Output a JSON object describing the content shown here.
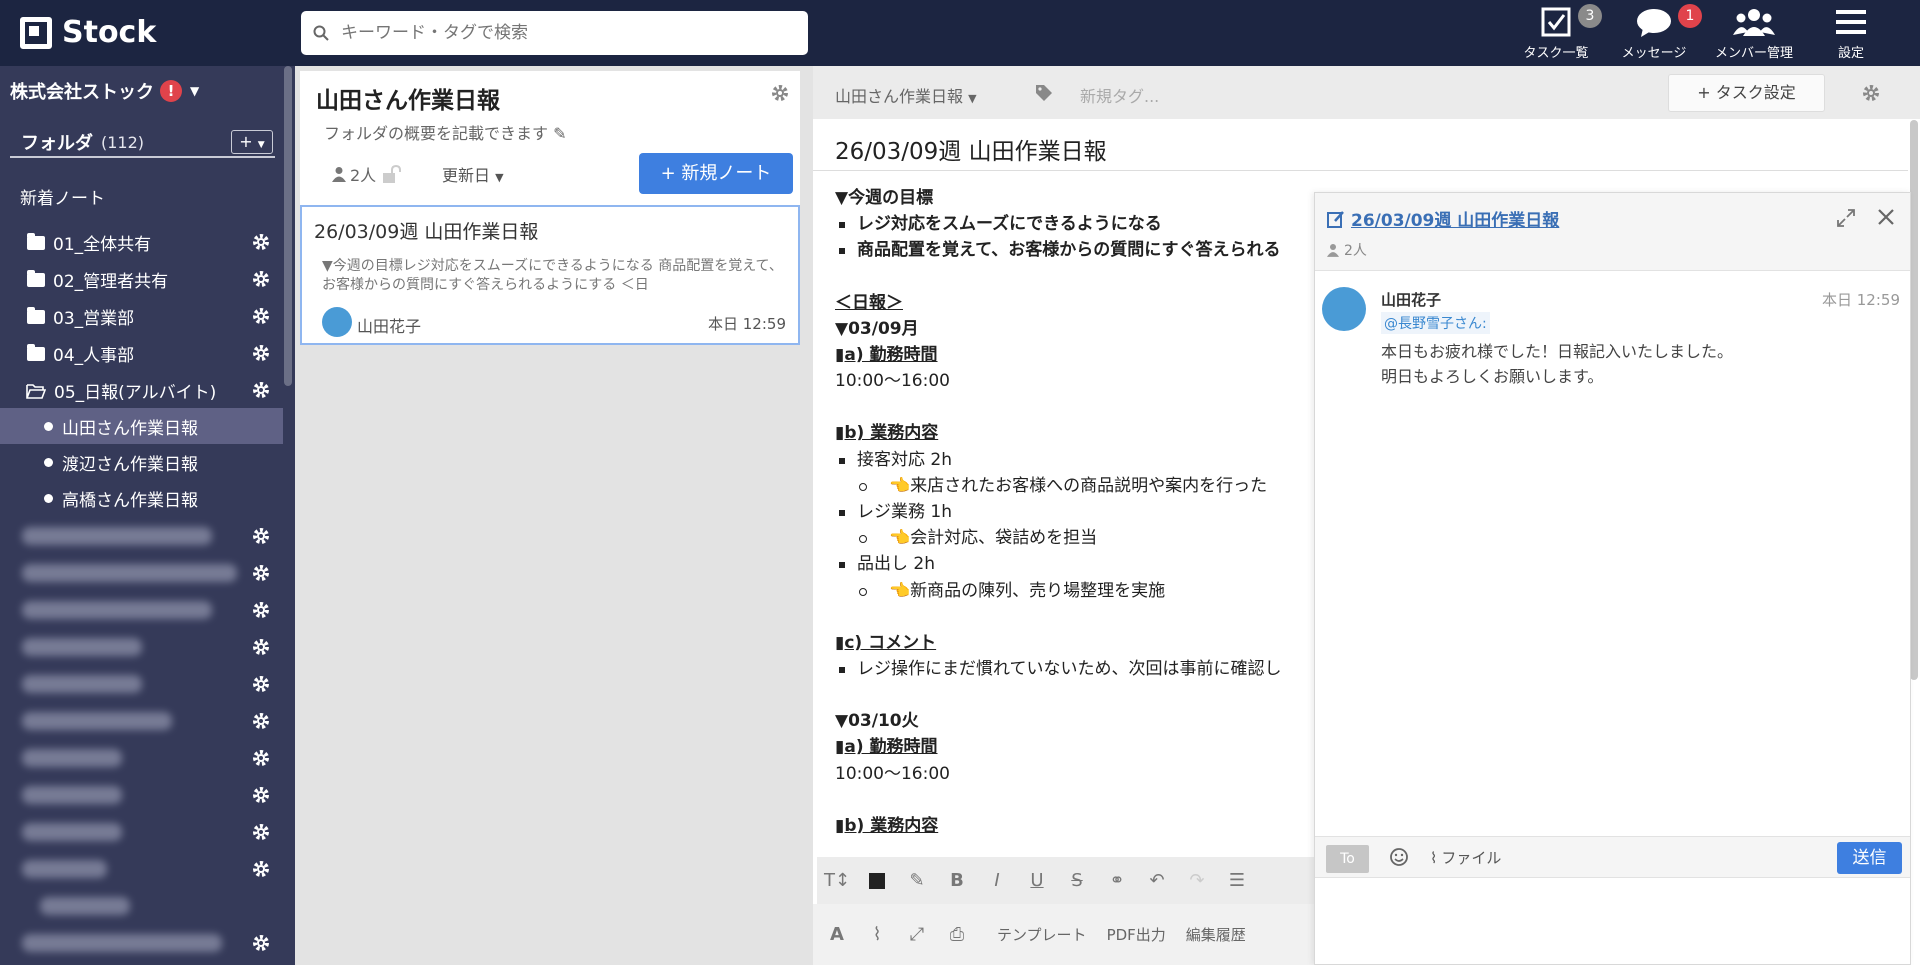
{
  "app": {
    "name": "Stock"
  },
  "search": {
    "placeholder": "キーワード・タグで検索"
  },
  "nav": {
    "tasks": {
      "label": "タスク一覧",
      "badge": "3"
    },
    "messages": {
      "label": "メッセージ",
      "badge": "1"
    },
    "members": {
      "label": "メンバー管理"
    },
    "settings": {
      "label": "設定"
    }
  },
  "sidebar": {
    "company": "株式会社ストック",
    "alert": "!",
    "folder_header": "フォルダ",
    "folder_count": "(112)",
    "add_label": "+",
    "new_notes": "新着ノート",
    "folders": [
      {
        "label": "01_全体共有"
      },
      {
        "label": "02_管理者共有"
      },
      {
        "label": "03_営業部"
      },
      {
        "label": "04_人事部"
      },
      {
        "label": "05_日報(アルバイト)"
      }
    ],
    "subfolders": [
      {
        "label": "山田さん作業日報",
        "active": true
      },
      {
        "label": "渡辺さん作業日報"
      },
      {
        "label": "高橋さん作業日報"
      }
    ]
  },
  "folder_view": {
    "title": "山田さん作業日報",
    "description": "フォルダの概要を記載できます",
    "members": "2人",
    "sort": "更新日",
    "new_note_button": "新規ノート",
    "note": {
      "title": "26/03/09週 山田作業日報",
      "snippet": "▼今週の目標レジ対応をスムーズにできるようになる 商品配置を覚えて、お客様からの質問にすぐ答えられるようにする ＜日",
      "author": "山田花子",
      "time": "本日 12:59"
    }
  },
  "editor": {
    "folder": "山田さん作業日報",
    "new_tag": "新規タグ...",
    "task_button": "タスク設定",
    "title": "26/03/09週 山田作業日報",
    "goal_heading": "▼今週の目標",
    "goals": [
      "レジ対応をスムーズにできるようになる",
      "商品配置を覚えて、お客様からの質問にすぐ答えられる"
    ],
    "report_heading": "＜日報＞",
    "day1": "▼03/09月",
    "work_hours_heading": "▮a) 勤務時間",
    "work_hours": "10:00〜16:00",
    "tasks_heading": "▮b) 業務内容",
    "tasks": [
      {
        "label": "接客対応 2h",
        "detail": "来店されたお客様への商品説明や案内を行った"
      },
      {
        "label": "レジ業務 1h",
        "detail": "会計対応、袋詰めを担当"
      },
      {
        "label": "品出し 2h",
        "detail": "新商品の陳列、売り場整理を実施"
      }
    ],
    "hand_icon": "👈",
    "comment_heading": "▮c) コメント",
    "comment": "レジ操作にまだ慣れていないため、次回は事前に確認し",
    "day2": "▼03/10火",
    "work_hours_heading2": "▮a) 勤務時間",
    "work_hours2": "10:00〜16:00",
    "tasks_heading2": "▮b) 業務内容",
    "toolbar_template": "テンプレート",
    "toolbar_pdf": "PDF出力",
    "toolbar_history": "編集履歴"
  },
  "chat": {
    "title": "26/03/09週 山田作業日報",
    "members": "2人",
    "message": {
      "author": "山田花子",
      "time": "本日 12:59",
      "mention": "@長野雪子さん:",
      "lines": [
        "本日もお疲れ様でした！日報記入いたしました。",
        "明日もよろしくお願いします。"
      ]
    },
    "to_label": "To",
    "file_label": "ファイル",
    "send_label": "送信"
  },
  "colors": {
    "nav_bg": "#1c2541",
    "sidebar_bg": "#353a59",
    "accent": "#3e7fe0",
    "alert": "#e0434b"
  }
}
